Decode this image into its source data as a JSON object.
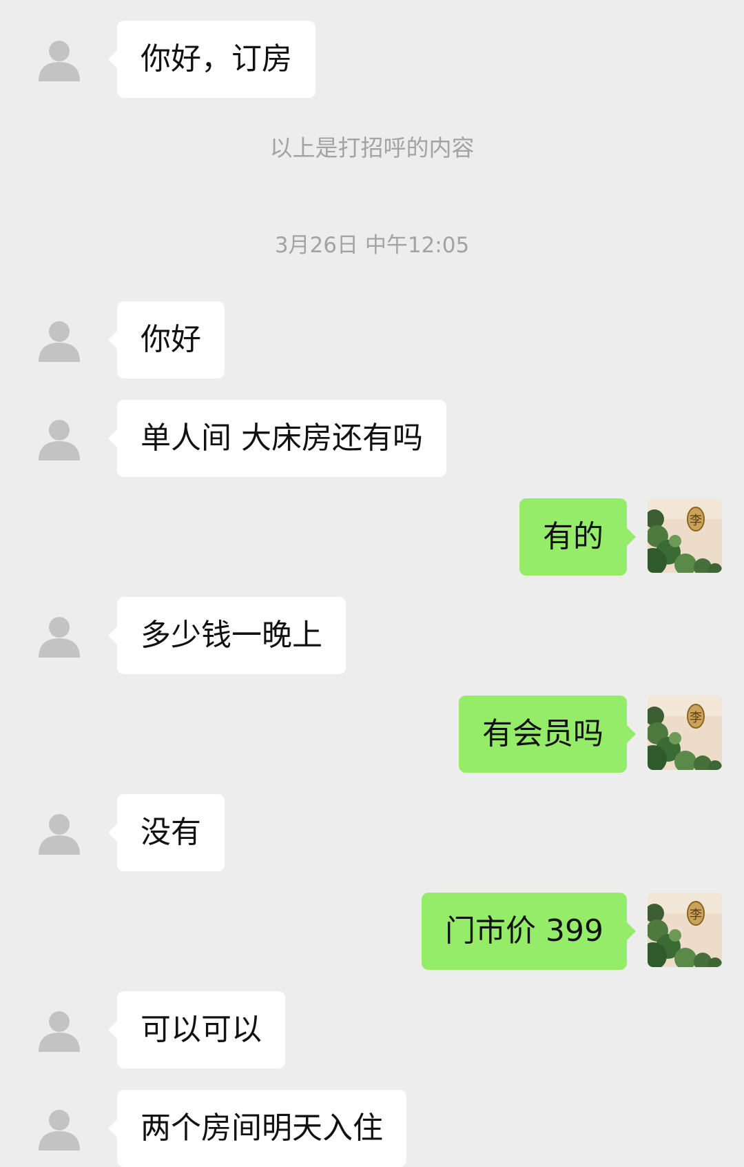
{
  "colors": {
    "background": "#ededed",
    "incoming_bubble": "#ffffff",
    "outgoing_bubble": "#95ec69",
    "system_text": "#a3a3a3"
  },
  "chat": {
    "greeting_note": "以上是打招呼的内容",
    "timestamp": "3月26日 中午12:05",
    "messages": [
      {
        "sender": "other",
        "text": "你好，订房",
        "avatar": "default-avatar-icon"
      },
      {
        "sender": "other",
        "text": "你好",
        "avatar": "default-avatar-icon"
      },
      {
        "sender": "other",
        "text": "单人间 大床房还有吗",
        "avatar": "default-avatar-icon"
      },
      {
        "sender": "self",
        "text": "有的",
        "avatar": "tree-badge-avatar"
      },
      {
        "sender": "other",
        "text": "多少钱一晚上",
        "avatar": "default-avatar-icon"
      },
      {
        "sender": "self",
        "text": "有会员吗",
        "avatar": "tree-badge-avatar"
      },
      {
        "sender": "other",
        "text": "没有",
        "avatar": "default-avatar-icon"
      },
      {
        "sender": "self",
        "text": "门市价 399",
        "avatar": "tree-badge-avatar"
      },
      {
        "sender": "other",
        "text": "可以可以",
        "avatar": "default-avatar-icon"
      },
      {
        "sender": "other",
        "text": "两个房间明天入住",
        "avatar": "default-avatar-icon"
      }
    ]
  }
}
